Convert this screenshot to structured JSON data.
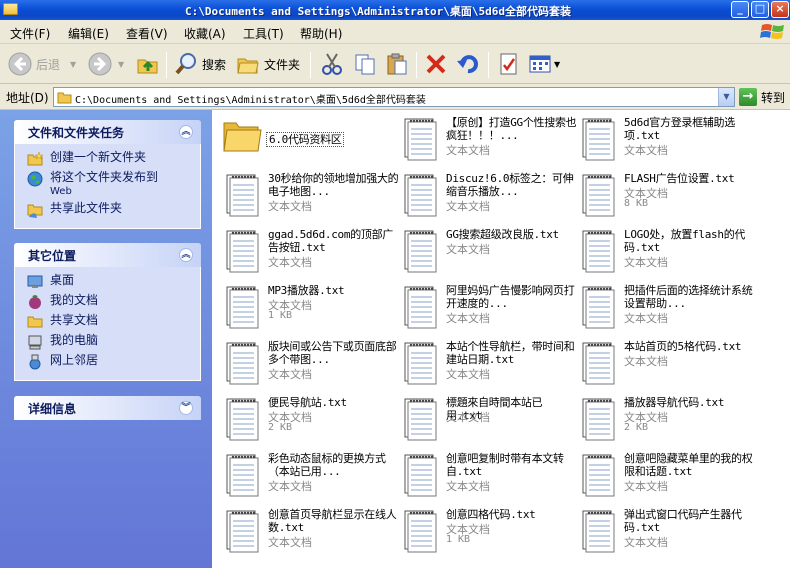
{
  "window": {
    "title": "C:\\Documents and Settings\\Administrator\\桌面\\5d6d全部代码套装",
    "minimize": "_",
    "maximize": "□",
    "close": "×"
  },
  "menu": [
    "文件(F)",
    "编辑(E)",
    "查看(V)",
    "收藏(A)",
    "工具(T)",
    "帮助(H)"
  ],
  "toolbar": {
    "back": "后退",
    "search": "搜索",
    "folders": "文件夹"
  },
  "address": {
    "label": "地址(D)",
    "path": "C:\\Documents and Settings\\Administrator\\桌面\\5d6d全部代码套装",
    "go": "转到"
  },
  "tasks_panel": {
    "title": "文件和文件夹任务",
    "items": [
      {
        "label": "创建一个新文件夹",
        "icon": "new-folder-icon"
      },
      {
        "label": "将这个文件夹发布到",
        "sub": "Web",
        "icon": "publish-web-icon"
      },
      {
        "label": "共享此文件夹",
        "icon": "share-folder-icon"
      }
    ]
  },
  "places_panel": {
    "title": "其它位置",
    "items": [
      {
        "label": "桌面",
        "icon": "desktop-icon"
      },
      {
        "label": "我的文档",
        "icon": "my-documents-icon"
      },
      {
        "label": "共享文档",
        "icon": "shared-documents-icon"
      },
      {
        "label": "我的电脑",
        "icon": "my-computer-icon"
      },
      {
        "label": "网上邻居",
        "icon": "network-places-icon"
      }
    ]
  },
  "details_panel": {
    "title": "详细信息"
  },
  "files": [
    {
      "name": "6.0代码资料区",
      "kind": "folder",
      "type": "",
      "size": ""
    },
    {
      "name": "【原创】打造GG个性搜索也疯狂！！！...",
      "kind": "text",
      "type": "文本文档",
      "size": ""
    },
    {
      "name": "5d6d官方登录框辅助选项.txt",
      "kind": "text",
      "type": "文本文档",
      "size": ""
    },
    {
      "name": "30秒给你的领地增加强大的电子地图...",
      "kind": "text",
      "type": "文本文档",
      "size": ""
    },
    {
      "name": "Discuz!6.0标签之：可伸缩音乐播放...",
      "kind": "text",
      "type": "文本文档",
      "size": ""
    },
    {
      "name": "FLASH广告位设置.txt",
      "kind": "text",
      "type": "文本文档",
      "size": "8 KB"
    },
    {
      "name": "ggad.5d6d.com的顶部广告按钮.txt",
      "kind": "text",
      "type": "文本文档",
      "size": ""
    },
    {
      "name": "GG搜索超级改良版.txt",
      "kind": "text",
      "type": "文本文档",
      "size": ""
    },
    {
      "name": "LOGO处，放置flash的代码.txt",
      "kind": "text",
      "type": "文本文档",
      "size": ""
    },
    {
      "name": "MP3播放器.txt",
      "kind": "text",
      "type": "文本文档",
      "size": "1 KB"
    },
    {
      "name": "阿里妈妈广告慢影响网页打开速度的...",
      "kind": "text",
      "type": "文本文档",
      "size": ""
    },
    {
      "name": "把插件后面的选择统计系统设置帮助...",
      "kind": "text",
      "type": "文本文档",
      "size": ""
    },
    {
      "name": "版块间或公告下或页面底部多个带图...",
      "kind": "text",
      "type": "文本文档",
      "size": ""
    },
    {
      "name": "本站个性导航栏，带时间和建站日期.txt",
      "kind": "text",
      "type": "文本文档",
      "size": ""
    },
    {
      "name": "本站首页的5格代码.txt",
      "kind": "text",
      "type": "文本文档",
      "size": ""
    },
    {
      "name": "便民导航站.txt",
      "kind": "text",
      "type": "文本文档",
      "size": "2 KB"
    },
    {
      "name": "標題來自時間本站已用.txt",
      "kind": "text",
      "type": "文本文档",
      "size": ""
    },
    {
      "name": "播放器导航代码.txt",
      "kind": "text",
      "type": "文本文档",
      "size": "2 KB"
    },
    {
      "name": "彩色动态鼠标的更换方式（本站已用...",
      "kind": "text",
      "type": "文本文档",
      "size": ""
    },
    {
      "name": "创意吧复制时带有本文转自.txt",
      "kind": "text",
      "type": "文本文档",
      "size": ""
    },
    {
      "name": "创意吧隐藏菜单里的我的权限和话题.txt",
      "kind": "text",
      "type": "文本文档",
      "size": ""
    },
    {
      "name": "创意首页导航栏显示在线人数.txt",
      "kind": "text",
      "type": "文本文档",
      "size": ""
    },
    {
      "name": "创意四格代码.txt",
      "kind": "text",
      "type": "文本文档",
      "size": "1 KB"
    },
    {
      "name": "弹出式窗口代码产生器代码.txt",
      "kind": "text",
      "type": "文本文档",
      "size": ""
    }
  ]
}
